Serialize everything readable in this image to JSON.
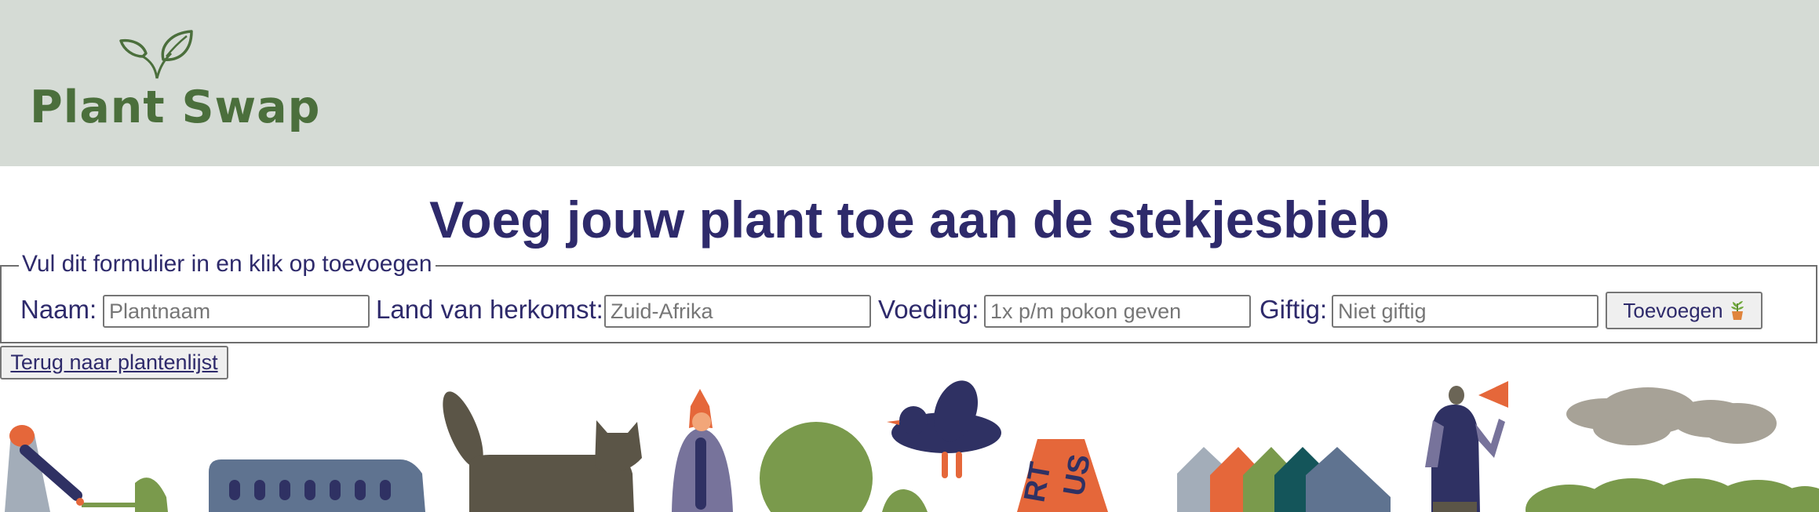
{
  "header": {
    "logo_text": "Plant Swap",
    "logo_icon": "leaves-icon",
    "background": "#d5dbd5",
    "brand_color": "#4b6f3c"
  },
  "page": {
    "title": "Voeg jouw plant toe aan de stekjesbieb",
    "text_color": "#2e2a6b"
  },
  "form": {
    "legend": "Vul dit formulier in en klik op toevoegen",
    "fields": [
      {
        "label": "Naam:",
        "value": "",
        "placeholder": "Plantnaam"
      },
      {
        "label": "Land van herkomst:",
        "value": "",
        "placeholder": "Zuid-Afrika"
      },
      {
        "label": "Voeding:",
        "value": "",
        "placeholder": "1x p/m pokon geven"
      },
      {
        "label": "Giftig:",
        "value": "",
        "placeholder": "Niet giftig"
      }
    ],
    "submit_label": "Toevoegen",
    "submit_icon": "potted-plant-icon"
  },
  "back_link": {
    "label": "Terug naar plantenlijst"
  },
  "illustration": {
    "sign_text": [
      "RT",
      "US"
    ],
    "colors": {
      "green": "#7a9a4c",
      "orange": "#e5673a",
      "navy": "#2f3163",
      "slate": "#5f7390",
      "brown": "#5b5547",
      "grey": "#a7a297",
      "teal": "#14555a",
      "purple": "#77739b"
    }
  }
}
